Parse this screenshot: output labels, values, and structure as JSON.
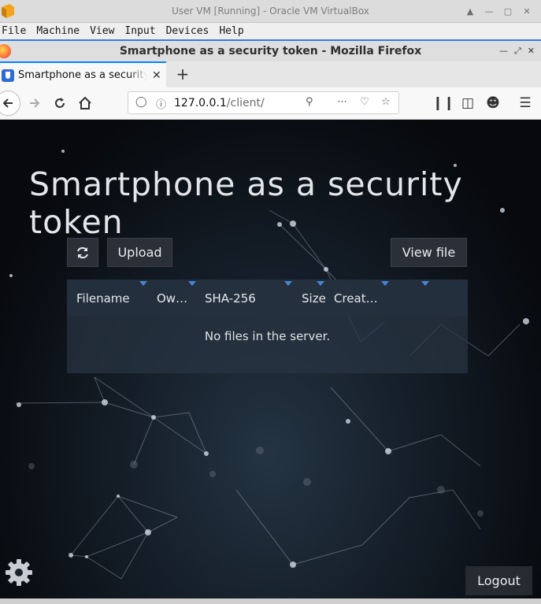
{
  "vbox": {
    "title": "User VM [Running] - Oracle VM VirtualBox",
    "menu": [
      "File",
      "Machine",
      "View",
      "Input",
      "Devices",
      "Help"
    ],
    "window_controls": [
      "up-arrow-icon",
      "minimize-icon",
      "maximize-icon",
      "close-icon"
    ]
  },
  "firefox": {
    "window_title": "Smartphone as a security token - Mozilla Firefox",
    "tab_label": "Smartphone as a security token",
    "url_host": "127.0.0.1",
    "url_path": "/client/"
  },
  "page": {
    "title": "Smartphone as a security token",
    "refresh_icon": "refresh-icon",
    "upload_label": "Upload",
    "view_file_label": "View file",
    "columns": [
      "Filename",
      "Ow…",
      "SHA-256",
      "Size",
      "Creat…"
    ],
    "empty_message": "No files in the server.",
    "logout_label": "Logout"
  },
  "colors": {
    "accent": "#0a84ff",
    "page_bg": "#141d27",
    "button_bg": "#2b3038"
  }
}
